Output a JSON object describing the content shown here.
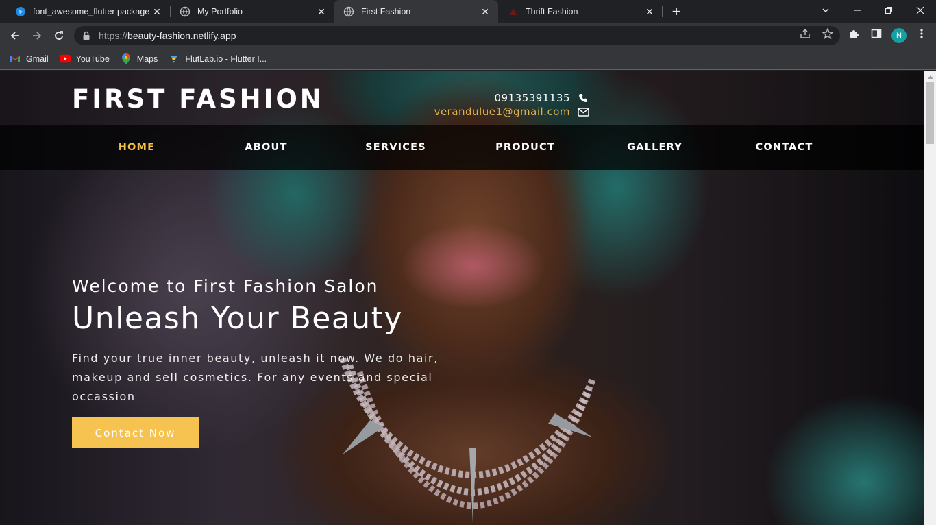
{
  "browser": {
    "tabs": [
      {
        "label": "font_awesome_flutter package - ",
        "icon": "dart-icon",
        "active": false
      },
      {
        "label": "My Portfolio",
        "icon": "globe-icon",
        "active": false
      },
      {
        "label": "First Fashion",
        "icon": "globe-icon",
        "active": true
      },
      {
        "label": "Thrift Fashion",
        "icon": "site-icon",
        "active": false
      }
    ],
    "url_scheme": "https://",
    "url_host": "beauty-fashion.netlify.app",
    "profile_initial": "N",
    "bookmarks": [
      {
        "label": "Gmail",
        "icon": "gmail-icon"
      },
      {
        "label": "YouTube",
        "icon": "youtube-icon"
      },
      {
        "label": "Maps",
        "icon": "maps-icon"
      },
      {
        "label": "FlutLab.io - Flutter I...",
        "icon": "flutlab-icon"
      }
    ]
  },
  "site": {
    "brand": "FIRST FASHION",
    "phone": "09135391135",
    "email": "verandulue1@gmail.com",
    "nav": [
      {
        "label": "HOME",
        "active": true
      },
      {
        "label": "ABOUT",
        "active": false
      },
      {
        "label": "SERVICES",
        "active": false
      },
      {
        "label": "PRODUCT",
        "active": false
      },
      {
        "label": "GALLERY",
        "active": false
      },
      {
        "label": "CONTACT",
        "active": false
      }
    ],
    "hero": {
      "welcome": "Welcome to First Fashion Salon",
      "headline": "Unleash Your Beauty",
      "description": "Find your true inner beauty, unleash it now. We do hair, makeup and sell cosmetics. For any events and special occassion",
      "cta": "Contact Now"
    }
  },
  "colors": {
    "accent_gold": "#f3bf47",
    "cta_bg": "#f7c350",
    "email": "#e3b14a"
  }
}
